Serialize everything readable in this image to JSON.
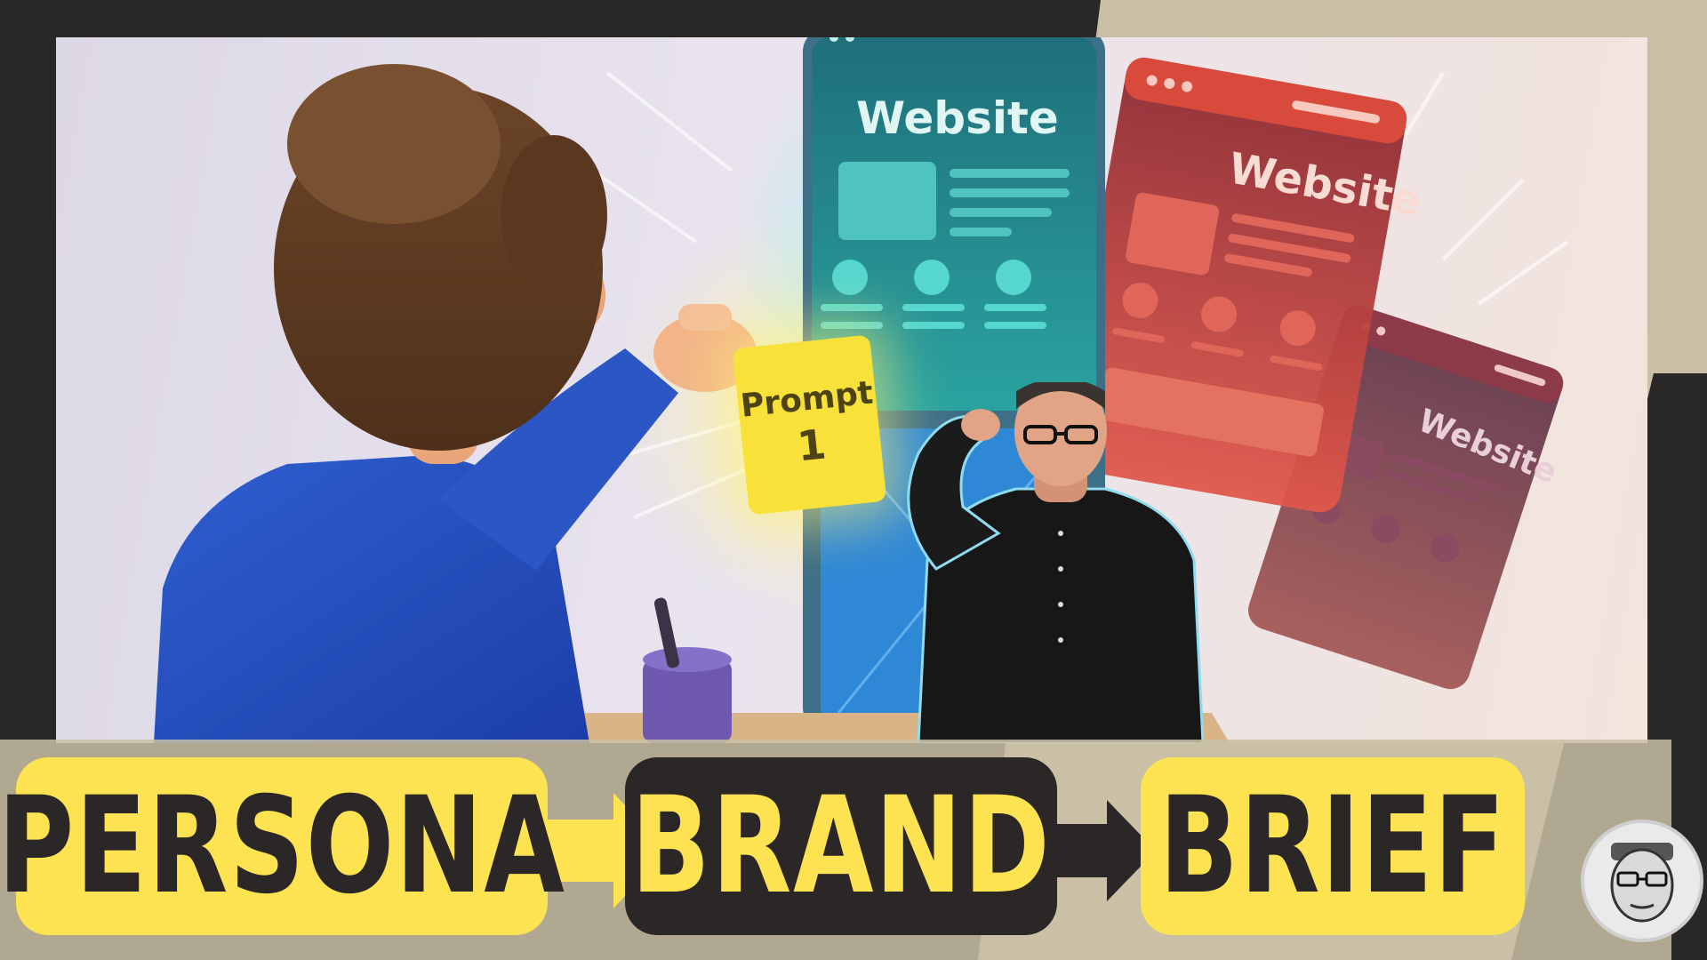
{
  "thumbnail": {
    "scene": {
      "prompt_card": {
        "line1": "Prompt",
        "line2": "1"
      },
      "websites": [
        {
          "title": "Website"
        },
        {
          "title": "Website"
        },
        {
          "title": "Website"
        }
      ]
    },
    "steps": [
      {
        "label": "PERSONA"
      },
      {
        "label": "BRAND"
      },
      {
        "label": "BRIEF"
      }
    ],
    "colors": {
      "frame_dark": "#2a2727",
      "frame_beige": "#c9bfa6",
      "pill_yellow": "#fde352",
      "pill_dark": "#2b2727",
      "arrow_yellow": "#fde352",
      "arrow_dark": "#2b2727",
      "teal_site": "#2a8f8e",
      "red_site": "#c8443c",
      "purple_site": "#6e3b52"
    },
    "icons": [
      "arrow-right-icon",
      "channel-avatar-icon"
    ]
  }
}
